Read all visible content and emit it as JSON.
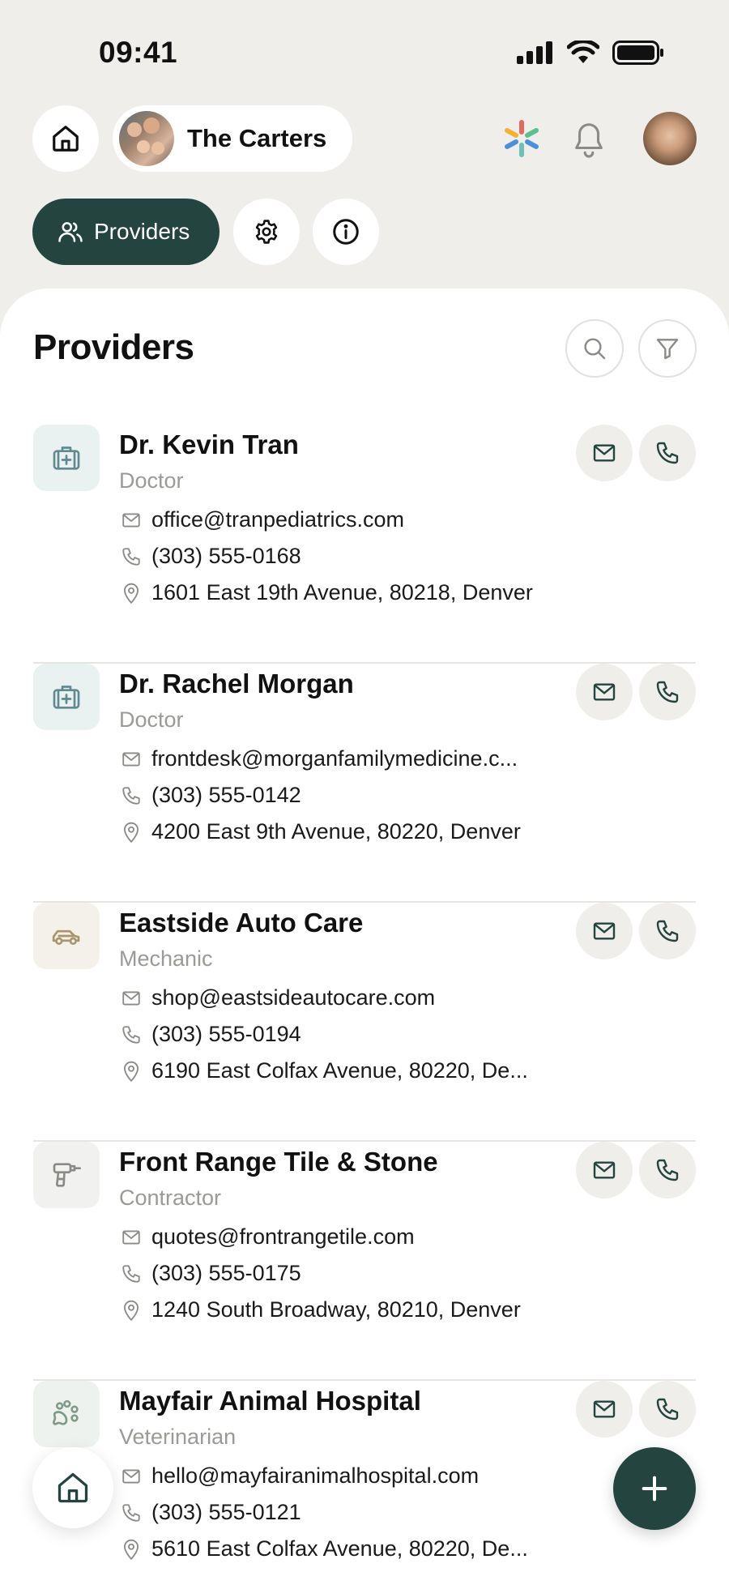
{
  "status": {
    "time": "09:41"
  },
  "header": {
    "family_name": "The Carters"
  },
  "tabs": {
    "providers_label": "Providers"
  },
  "page": {
    "title": "Providers"
  },
  "providers": [
    {
      "name": "Dr. Kevin Tran",
      "category": "Doctor",
      "icon": "medical-kit-icon",
      "email": "office@tranpediatrics.com",
      "phone": "(303) 555-0168",
      "address": "1601 East 19th Avenue, 80218, Denver"
    },
    {
      "name": "Dr. Rachel Morgan",
      "category": "Doctor",
      "icon": "medical-kit-icon",
      "email": "frontdesk@morganfamilymedicine.c...",
      "phone": "(303) 555-0142",
      "address": "4200 East 9th Avenue, 80220, Denver"
    },
    {
      "name": "Eastside Auto Care",
      "category": "Mechanic",
      "icon": "car-icon",
      "email": "shop@eastsideautocare.com",
      "phone": "(303) 555-0194",
      "address": "6190 East Colfax Avenue, 80220, De..."
    },
    {
      "name": "Front Range Tile & Stone",
      "category": "Contractor",
      "icon": "drill-icon",
      "email": "quotes@frontrangetile.com",
      "phone": "(303) 555-0175",
      "address": "1240 South Broadway, 80210, Denver"
    },
    {
      "name": "Mayfair Animal Hospital",
      "category": "Veterinarian",
      "icon": "paw-icon",
      "email": "hello@mayfairanimalhospital.com",
      "phone": "(303) 555-0121",
      "address": "5610 East Colfax Avenue, 80220, De..."
    }
  ],
  "colors": {
    "accent": "#23443f",
    "background": "#efeeeb",
    "doctor_icon": "#5f8a90",
    "mechanic_icon": "#a8956a",
    "muted_text": "#9a9a96"
  }
}
